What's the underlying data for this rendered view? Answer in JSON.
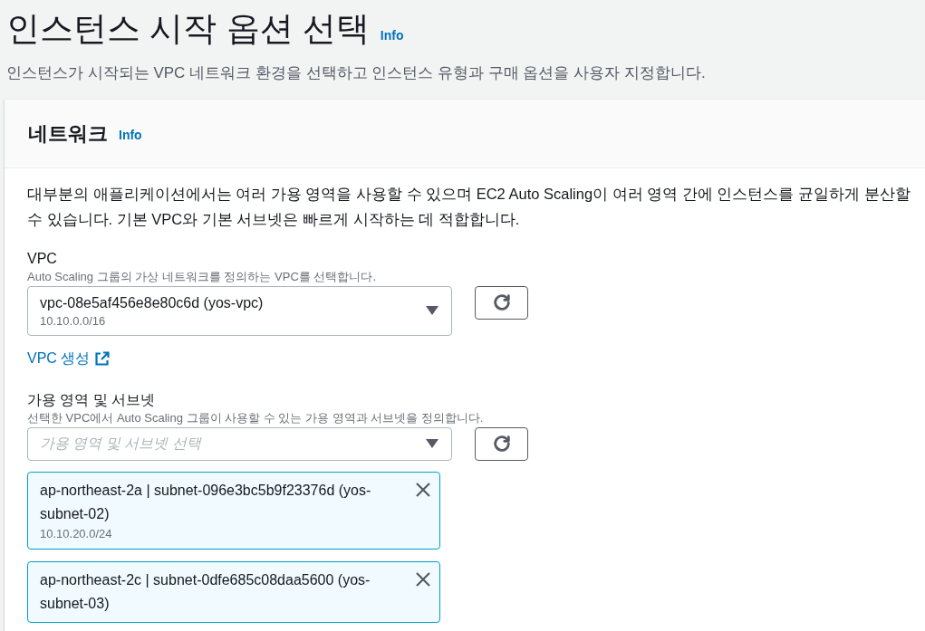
{
  "page": {
    "title": "인스턴스 시작 옵션 선택",
    "info": "Info",
    "description": "인스턴스가 시작되는 VPC 네트워크 환경을 선택하고 인스턴스 유형과 구매 옵션을 사용자 지정합니다."
  },
  "network": {
    "title": "네트워크",
    "info": "Info",
    "description": "대부분의 애플리케이션에서는 여러 가용 영역을 사용할 수 있으며 EC2 Auto Scaling이 여러 영역 간에 인스턴스를 균일하게 분산할 수 있습니다. 기본 VPC와 기본 서브넷은 빠르게 시작하는 데 적합합니다.",
    "vpc": {
      "label": "VPC",
      "hint": "Auto Scaling 그룹의 가상 네트워크를 정의하는 VPC를 선택합니다.",
      "value": "vpc-08e5af456e8e80c6d (yos-vpc)",
      "value_detail": "10.10.0.0/16",
      "create_link": "VPC 생성"
    },
    "subnets": {
      "label": "가용 영역 및 서브넷",
      "hint": "선택한 VPC에서 Auto Scaling 그룹이 사용할 수 있는 가용 영역과 서브넷을 정의합니다.",
      "placeholder": "가용 영역 및 서브넷 선택",
      "tokens": [
        {
          "label": "ap-northeast-2a | subnet-096e3bc5b9f23376d (yos-subnet-02)",
          "detail": "10.10.20.0/24"
        },
        {
          "label": "ap-northeast-2c | subnet-0dfe685c08daa5600 (yos-subnet-03)"
        }
      ]
    }
  }
}
